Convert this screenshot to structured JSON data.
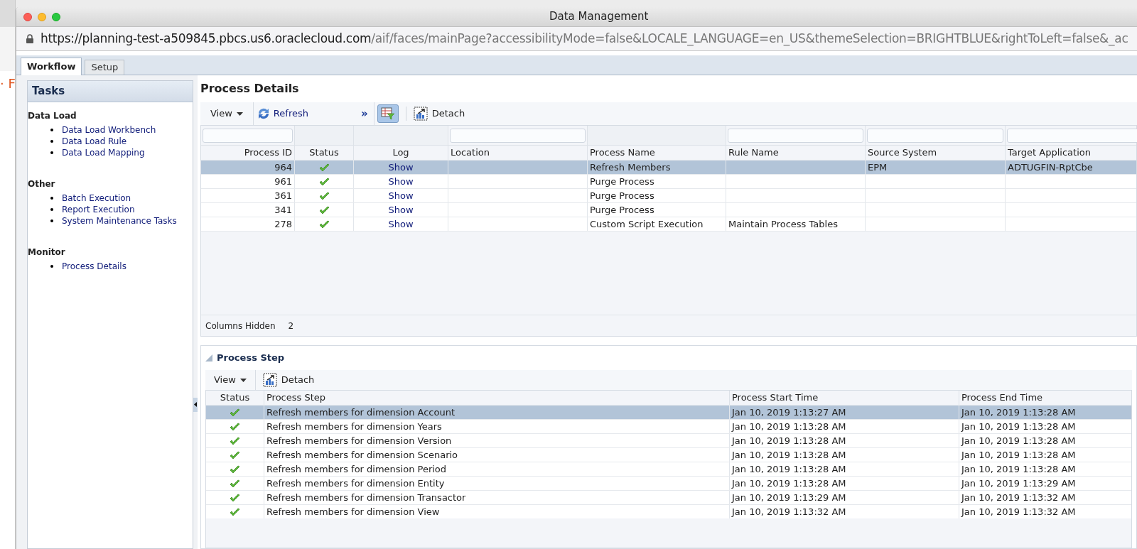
{
  "background_window": {
    "text": "· F"
  },
  "window": {
    "title": "Data Management",
    "url_host": "https://planning-test-a509845.pbcs.us6.oraclecloud.com",
    "url_path": "/aif/faces/mainPage?accessibilityMode=false&LOCALE_LANGUAGE=en_US&themeSelection=BRIGHTBLUE&rightToLeft=false&_ac"
  },
  "tabs": [
    {
      "label": "Workflow",
      "selected": true
    },
    {
      "label": "Setup",
      "selected": false
    }
  ],
  "sidebar": {
    "title": "Tasks",
    "sections": [
      {
        "title": "Data Load",
        "items": [
          "Data Load Workbench",
          "Data Load Rule",
          "Data Load Mapping"
        ]
      },
      {
        "title": "Other",
        "items": [
          "Batch Execution",
          "Report Execution",
          "System Maintenance Tasks"
        ]
      },
      {
        "title": "Monitor",
        "items": [
          "Process Details"
        ]
      }
    ]
  },
  "process_details": {
    "title": "Process Details",
    "toolbar": {
      "view": "View",
      "refresh": "Refresh",
      "overflow": "»",
      "detach": "Detach"
    },
    "columns": [
      {
        "label": "Process ID",
        "filterable": true
      },
      {
        "label": "Status",
        "filterable": false
      },
      {
        "label": "Log",
        "filterable": false
      },
      {
        "label": "Location",
        "filterable": true
      },
      {
        "label": "Process Name",
        "filterable": false
      },
      {
        "label": "Rule Name",
        "filterable": true
      },
      {
        "label": "Source System",
        "filterable": true
      },
      {
        "label": "Target Application",
        "filterable": true
      }
    ],
    "rows": [
      {
        "selected": true,
        "id": "964",
        "log": "Show",
        "location": "",
        "process_name": "Refresh Members",
        "rule_name": "",
        "source_system": "EPM",
        "target_application": "ADTUGFIN-RptCbe"
      },
      {
        "selected": false,
        "id": "961",
        "log": "Show",
        "location": "",
        "process_name": "Purge Process",
        "rule_name": "",
        "source_system": "",
        "target_application": ""
      },
      {
        "selected": false,
        "id": "361",
        "log": "Show",
        "location": "",
        "process_name": "Purge Process",
        "rule_name": "",
        "source_system": "",
        "target_application": ""
      },
      {
        "selected": false,
        "id": "341",
        "log": "Show",
        "location": "",
        "process_name": "Purge Process",
        "rule_name": "",
        "source_system": "",
        "target_application": ""
      },
      {
        "selected": false,
        "id": "278",
        "log": "Show",
        "location": "",
        "process_name": "Custom Script Execution",
        "rule_name": "Maintain Process Tables",
        "source_system": "",
        "target_application": ""
      }
    ],
    "footer": {
      "label": "Columns Hidden",
      "value": "2"
    }
  },
  "process_step": {
    "title": "Process Step",
    "toolbar": {
      "view": "View",
      "detach": "Detach"
    },
    "columns": [
      "Status",
      "Process Step",
      "Process Start Time",
      "Process End Time"
    ],
    "rows": [
      {
        "selected": true,
        "step": "Refresh members for dimension Account",
        "start": "Jan 10, 2019 1:13:27 AM",
        "end": "Jan 10, 2019 1:13:28 AM"
      },
      {
        "selected": false,
        "step": "Refresh members for dimension Years",
        "start": "Jan 10, 2019 1:13:28 AM",
        "end": "Jan 10, 2019 1:13:28 AM"
      },
      {
        "selected": false,
        "step": "Refresh members for dimension Version",
        "start": "Jan 10, 2019 1:13:28 AM",
        "end": "Jan 10, 2019 1:13:28 AM"
      },
      {
        "selected": false,
        "step": "Refresh members for dimension Scenario",
        "start": "Jan 10, 2019 1:13:28 AM",
        "end": "Jan 10, 2019 1:13:28 AM"
      },
      {
        "selected": false,
        "step": "Refresh members for dimension Period",
        "start": "Jan 10, 2019 1:13:28 AM",
        "end": "Jan 10, 2019 1:13:28 AM"
      },
      {
        "selected": false,
        "step": "Refresh members for dimension Entity",
        "start": "Jan 10, 2019 1:13:28 AM",
        "end": "Jan 10, 2019 1:13:29 AM"
      },
      {
        "selected": false,
        "step": "Refresh members for dimension Transactor",
        "start": "Jan 10, 2019 1:13:29 AM",
        "end": "Jan 10, 2019 1:13:32 AM"
      },
      {
        "selected": false,
        "step": "Refresh members for dimension View",
        "start": "Jan 10, 2019 1:13:32 AM",
        "end": "Jan 10, 2019 1:13:32 AM"
      }
    ]
  }
}
